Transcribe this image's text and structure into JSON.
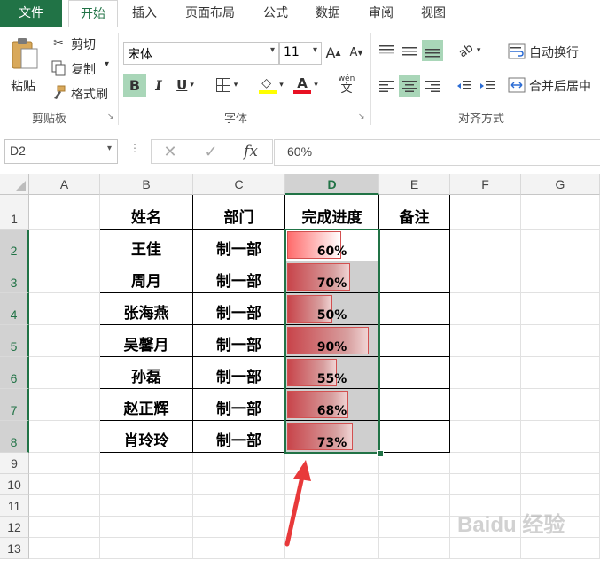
{
  "tabs": [
    "文件",
    "开始",
    "插入",
    "页面布局",
    "公式",
    "数据",
    "审阅",
    "视图"
  ],
  "active_tab": "开始",
  "clipboard": {
    "paste": "粘贴",
    "cut": "剪切",
    "copy": "复制",
    "format_painter": "格式刷",
    "group_label": "剪贴板"
  },
  "font": {
    "name": "宋体",
    "size": "11",
    "grow": "A",
    "shrink": "A",
    "bold": "B",
    "italic": "I",
    "underline": "U",
    "font_color": "A",
    "phonetic": "wén",
    "group_label": "字体"
  },
  "alignment": {
    "wrap_text": "自动换行",
    "merge_center": "合并后居中",
    "group_label": "对齐方式"
  },
  "formula_bar": {
    "name_box": "D2",
    "fx": "fx",
    "value": "60%"
  },
  "columns": [
    "A",
    "B",
    "C",
    "D",
    "E",
    "F",
    "G"
  ],
  "rows": [
    "1",
    "2",
    "3",
    "4",
    "5",
    "6",
    "7",
    "8",
    "9",
    "10",
    "11",
    "12",
    "13"
  ],
  "table": {
    "headers": [
      "姓名",
      "部门",
      "完成进度",
      "备注"
    ],
    "records": [
      {
        "name": "王佳",
        "dept": "制一部",
        "progress": "60%",
        "value": 0.6
      },
      {
        "name": "周月",
        "dept": "制一部",
        "progress": "70%",
        "value": 0.7
      },
      {
        "name": "张海燕",
        "dept": "制一部",
        "progress": "50%",
        "value": 0.5
      },
      {
        "name": "吴馨月",
        "dept": "制一部",
        "progress": "90%",
        "value": 0.9
      },
      {
        "name": "孙磊",
        "dept": "制一部",
        "progress": "55%",
        "value": 0.55
      },
      {
        "name": "赵正辉",
        "dept": "制一部",
        "progress": "68%",
        "value": 0.68
      },
      {
        "name": "肖玲玲",
        "dept": "制一部",
        "progress": "73%",
        "value": 0.73
      }
    ]
  },
  "colors": {
    "accent": "#217346",
    "bar_red": "#c8454b",
    "bar_gray": "#cfcfcf",
    "arrow": "#e8393a"
  },
  "watermark": "Baidu 经验"
}
